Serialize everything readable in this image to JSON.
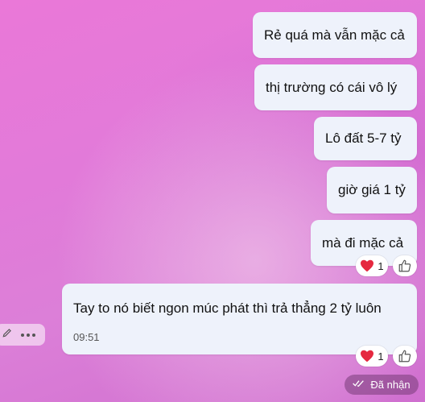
{
  "messages": [
    {
      "text": "Rẻ quá mà vẫn mặc cả"
    },
    {
      "text": "thị trường có cái vô lý"
    },
    {
      "text": "Lô đất 5-7 tỷ"
    },
    {
      "text": "giờ giá 1 tỷ"
    },
    {
      "text": "mà đi mặc cả",
      "reaction": {
        "icon": "heart-icon",
        "count": "1"
      }
    },
    {
      "text": "Tay to nó biết ngon múc phát thì trả thẳng 2 tỷ luôn",
      "time": "09:51",
      "reaction": {
        "icon": "heart-icon",
        "count": "1"
      }
    }
  ],
  "status": {
    "label": "Đã nhận",
    "icon": "double-check-icon"
  },
  "colors": {
    "bubble": "#eef2fb",
    "heart": "#e5283f"
  }
}
